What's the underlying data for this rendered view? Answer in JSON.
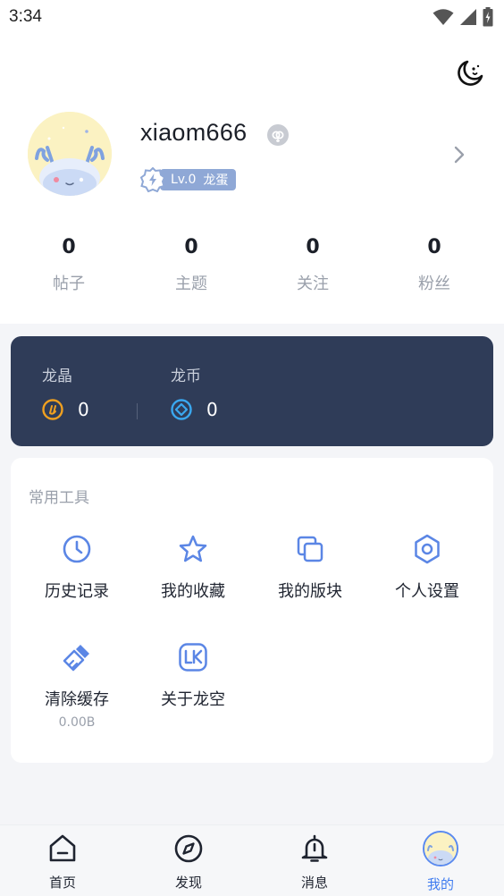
{
  "status_bar": {
    "time": "3:34"
  },
  "profile": {
    "username": "xiaom666",
    "level": "Lv.0",
    "level_title": "龙蛋"
  },
  "stats": [
    {
      "value": "0",
      "label": "帖子"
    },
    {
      "value": "0",
      "label": "主题"
    },
    {
      "value": "0",
      "label": "关注"
    },
    {
      "value": "0",
      "label": "粉丝"
    }
  ],
  "wallet": {
    "crystal_label": "龙晶",
    "crystal_value": "0",
    "coin_label": "龙币",
    "coin_value": "0",
    "crystal_color": "#f0a020",
    "coin_color": "#3aa8f0"
  },
  "tools": {
    "title": "常用工具",
    "items": [
      {
        "label": "历史记录",
        "icon": "clock-icon"
      },
      {
        "label": "我的收藏",
        "icon": "star-icon"
      },
      {
        "label": "我的版块",
        "icon": "copy-icon"
      },
      {
        "label": "个人设置",
        "icon": "gear-icon"
      },
      {
        "label": "清除缓存",
        "icon": "brush-icon",
        "sub": "0.00B"
      },
      {
        "label": "关于龙空",
        "icon": "lk-logo-icon"
      }
    ],
    "accent": "#5b86e5"
  },
  "tabbar": {
    "items": [
      {
        "label": "首页",
        "icon": "home-icon"
      },
      {
        "label": "发现",
        "icon": "compass-icon"
      },
      {
        "label": "消息",
        "icon": "bell-icon"
      },
      {
        "label": "我的",
        "icon": "avatar-icon"
      }
    ],
    "active_index": 3,
    "active_color": "#3f7cf0"
  }
}
